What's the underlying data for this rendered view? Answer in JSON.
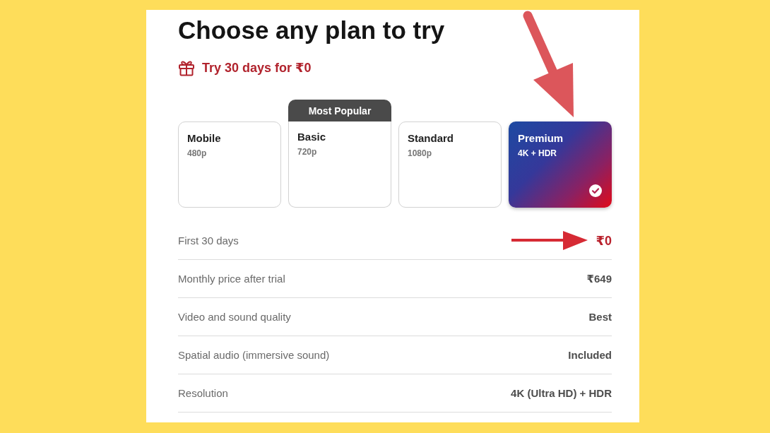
{
  "title": "Choose any plan to try",
  "offer": {
    "text": "Try 30 days for ₹0"
  },
  "plans": [
    {
      "name": "Mobile",
      "resolution": "480p",
      "selected": false
    },
    {
      "name": "Basic",
      "resolution": "720p",
      "selected": false,
      "badge": "Most Popular"
    },
    {
      "name": "Standard",
      "resolution": "1080p",
      "selected": false
    },
    {
      "name": "Premium",
      "resolution": "4K + HDR",
      "selected": true
    }
  ],
  "details": [
    {
      "label": "First 30 days",
      "value": "₹0",
      "kind": "offer"
    },
    {
      "label": "Monthly price after trial",
      "value": "₹649",
      "kind": "plain"
    },
    {
      "label": "Video and sound quality",
      "value": "Best",
      "kind": "plain"
    },
    {
      "label": "Spatial audio (immersive sound)",
      "value": "Included",
      "kind": "plain"
    },
    {
      "label": "Resolution",
      "value": "4K (Ultra HD) + HDR",
      "kind": "plain"
    }
  ]
}
